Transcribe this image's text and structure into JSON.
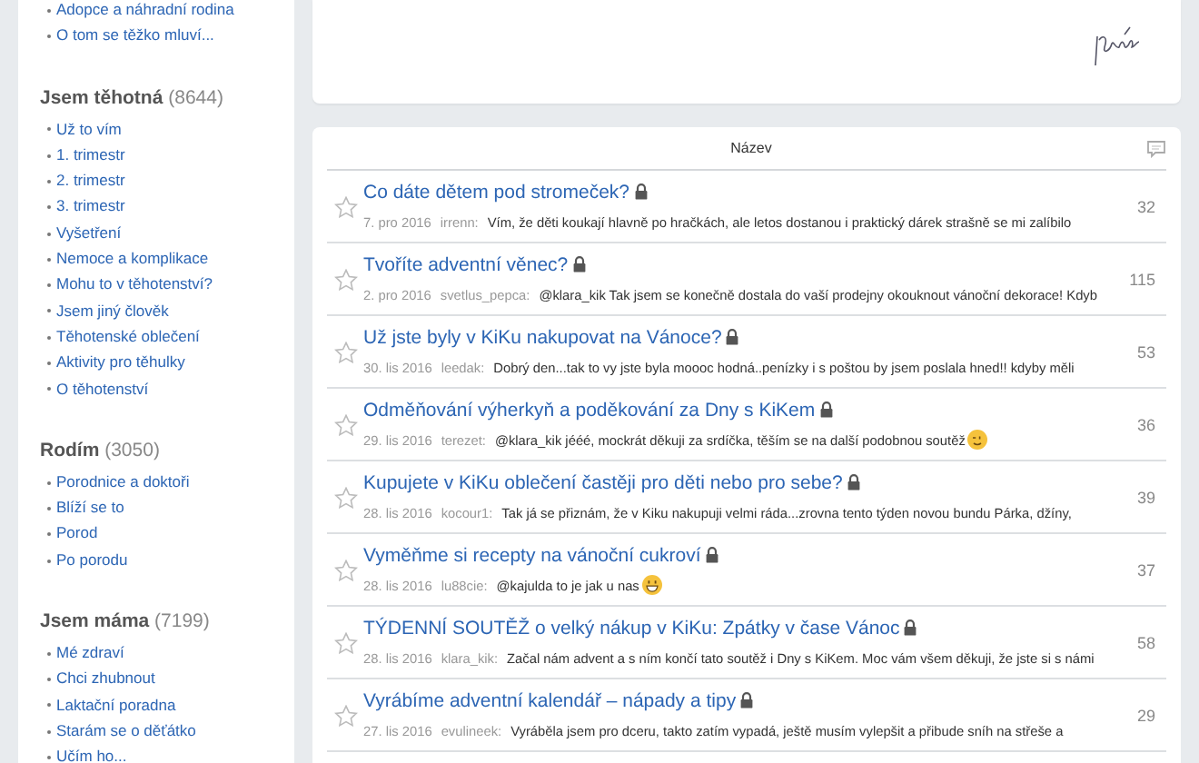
{
  "sidebar": {
    "groups": [
      {
        "items": [
          "Adopce a náhradní rodina",
          "O tom se těžko mluví..."
        ]
      },
      {
        "title": "Jsem těhotná",
        "count": "(8644)",
        "items": [
          "Už to vím",
          "1. trimestr",
          "2. trimestr",
          "3. trimestr",
          "Vyšetření",
          "Nemoce a komplikace",
          "Mohu to v těhotenství?",
          "Jsem jiný člověk",
          "Těhotenské oblečení",
          "Aktivity pro těhulky",
          "O těhotenství"
        ]
      },
      {
        "title": "Rodím",
        "count": "(3050)",
        "items": [
          "Porodnice a doktoři",
          "Blíží se to",
          "Porod",
          "Po porodu"
        ]
      },
      {
        "title": "Jsem máma",
        "count": "(7199)",
        "items": [
          "Mé zdraví",
          "Chci zhubnout",
          "Laktační poradna",
          "Starám se o děťátko",
          "Učím ho..."
        ]
      }
    ]
  },
  "topics": {
    "header": "Název",
    "rows": [
      {
        "title": "Co dáte dětem pod stromeček?",
        "locked": true,
        "starred": false,
        "date": "7. pro 2016",
        "user": "irrenn:",
        "snippet": "Vím, že děti koukají hlavně po hračkách, ale letos dostanou i praktický dárek strašně se mi zalíbilo",
        "comments": "32"
      },
      {
        "title": "Tvoříte adventní věnec?",
        "locked": true,
        "starred": false,
        "date": "2. pro 2016",
        "user": "svetlus_pepca:",
        "snippet": "@klara_kik Tak jsem se konečně dostala do vaší prodejny okouknout vánoční dekorace! Kdyb",
        "comments": "115"
      },
      {
        "title": "Už jste byly v KiKu nakupovat na Vánoce?",
        "locked": true,
        "starred": false,
        "date": "30. lis 2016",
        "user": "leedak:",
        "snippet": "Dobrý den...tak to vy jste byla moooc hodná..penízky i s poštou by jsem poslala hned!! kdyby měli",
        "comments": "53"
      },
      {
        "title": "Odměňování výherkyň a poděkování za Dny s KiKem",
        "locked": true,
        "starred": false,
        "date": "29. lis 2016",
        "user": "terezet:",
        "snippet": "@klara_kik jééé, mockrát děkuji za srdíčka, těším se na další podobnou soutěž",
        "emoji": {
          "kind": "wink"
        },
        "comments": "36"
      },
      {
        "title": "Kupujete v KiKu oblečení častěji pro děti nebo pro sebe?",
        "locked": true,
        "starred": false,
        "date": "28. lis 2016",
        "user": "kocour1:",
        "snippet": "Tak já se přiznám, že v Kiku nakupuji velmi ráda...zrovna tento týden novou bundu Párka, džíny,",
        "comments": "39"
      },
      {
        "title": "Vyměňme si recepty na vánoční cukroví",
        "locked": true,
        "starred": false,
        "date": "28. lis 2016",
        "user": "lu88cie:",
        "snippet": "@kajulda to je jak u nas",
        "emoji": {
          "kind": "grin"
        },
        "comments": "37"
      },
      {
        "title": "TÝDENNÍ SOUTĚŽ o velký nákup v KiKu: Zpátky v čase Vánoc",
        "locked": true,
        "starred": false,
        "date": "28. lis 2016",
        "user": "klara_kik:",
        "snippet": "Začal nám advent a s ním končí tato soutěž i Dny s KiKem. Moc vám všem děkuji, že jste si s námi",
        "comments": "58"
      },
      {
        "title": "Vyrábíme adventní kalendář – nápady a tipy",
        "locked": true,
        "starred": false,
        "date": "27. lis 2016",
        "user": "evulineek:",
        "snippet": "Vyráběla jsem pro dceru, takto zatím vypadá, ještě musím vylepšit a přibude sníh na střeše a",
        "comments": "29"
      }
    ]
  }
}
